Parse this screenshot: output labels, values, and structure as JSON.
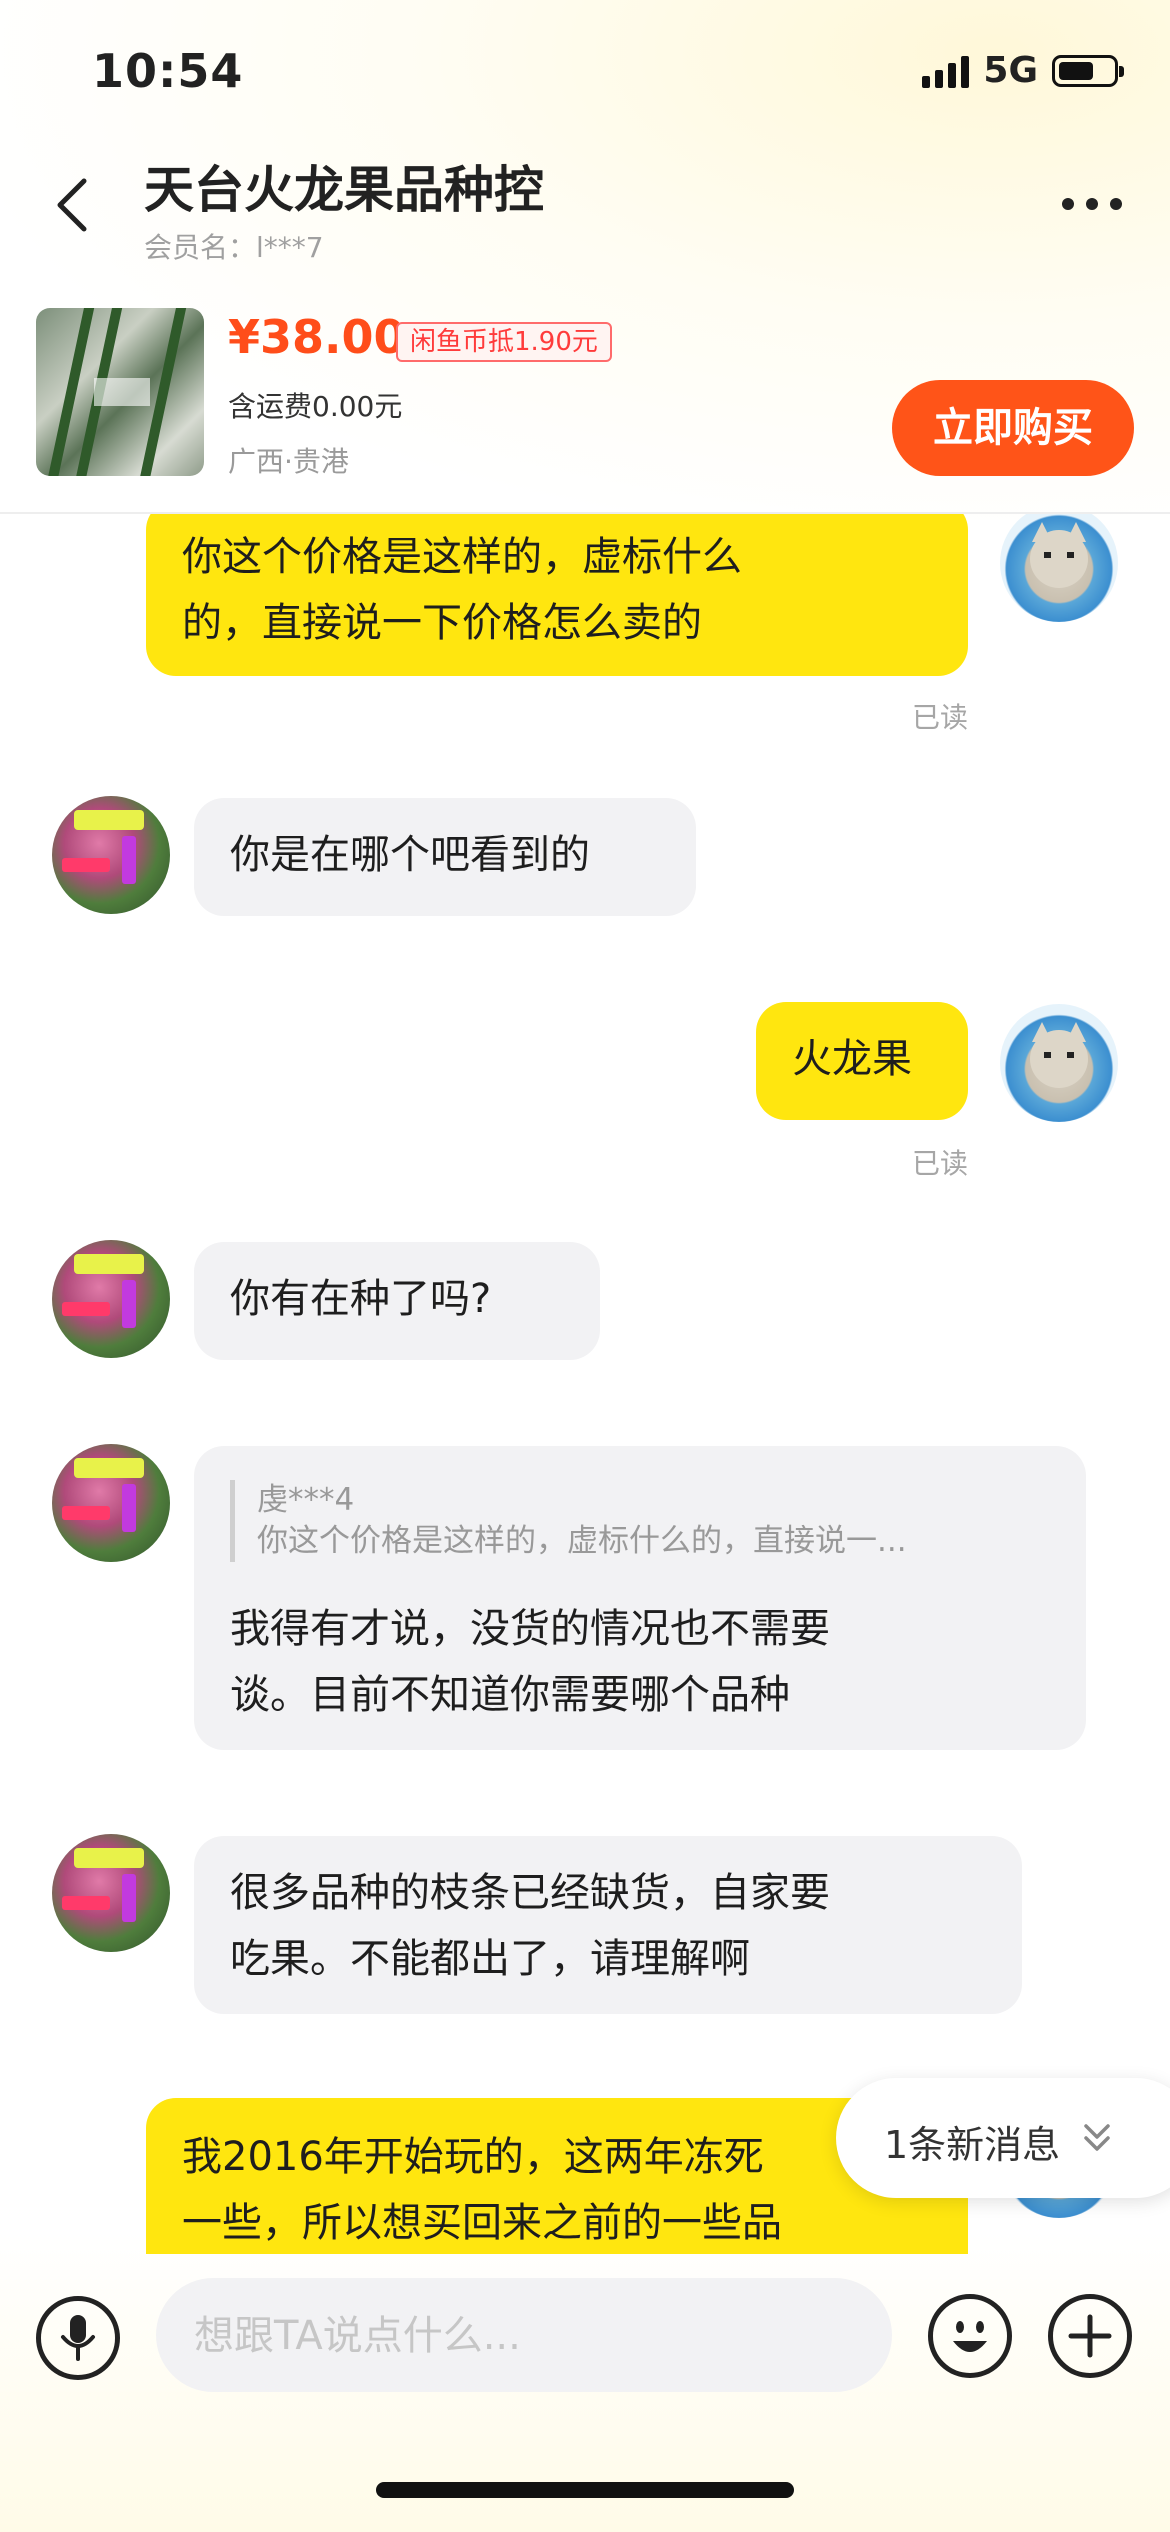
{
  "status_bar": {
    "time": "10:54",
    "network": "5G",
    "battery_level": 0.65
  },
  "header": {
    "title": "天台火龙果品种控",
    "subtitle": "会员名：l***7"
  },
  "product": {
    "price": "¥38.00",
    "coin_discount": "闲鱼币抵1.90元",
    "shipping": "含运费0.00元",
    "location": "广西·贵港",
    "buy_label": "立即购买"
  },
  "messages": [
    {
      "from": "me",
      "lines": [
        "你这个价格是这样的，虚标什么",
        "的，直接说一下价格怎么卖的"
      ],
      "status": "已读"
    },
    {
      "from": "them",
      "lines": [
        "你是在哪个吧看到的"
      ]
    },
    {
      "from": "me",
      "lines": [
        "火龙果"
      ],
      "status": "已读"
    },
    {
      "from": "them",
      "lines": [
        "你有在种了吗?"
      ]
    },
    {
      "from": "them",
      "quote": {
        "name": "虔***4",
        "text": "你这个价格是这样的，虚标什么的，直接说一..."
      },
      "lines": [
        "我得有才说，没货的情况也不需要",
        "谈。目前不知道你需要哪个品种"
      ]
    },
    {
      "from": "them",
      "lines": [
        "很多品种的枝条已经缺货，自家要",
        "吃果。不能都出了，请理解啊"
      ]
    },
    {
      "from": "me",
      "lines": [
        "我2016年开始玩的，这两年冻死",
        "一些，所以想买回来之前的一些品"
      ]
    }
  ],
  "new_messages_label": "1条新消息",
  "input": {
    "placeholder": "想跟TA说点什么..."
  },
  "icons": {
    "back": "chevron-left-icon",
    "more": "more-dots-icon",
    "mic": "microphone-icon",
    "emoji": "emoji-icon",
    "plus": "plus-icon",
    "new_msg": "double-chevron-down-icon"
  },
  "colors": {
    "my_bubble": "#ffe60f",
    "their_bubble": "#f2f2f4",
    "buy_button": "#ff5418",
    "price": "#ff4d1a"
  }
}
